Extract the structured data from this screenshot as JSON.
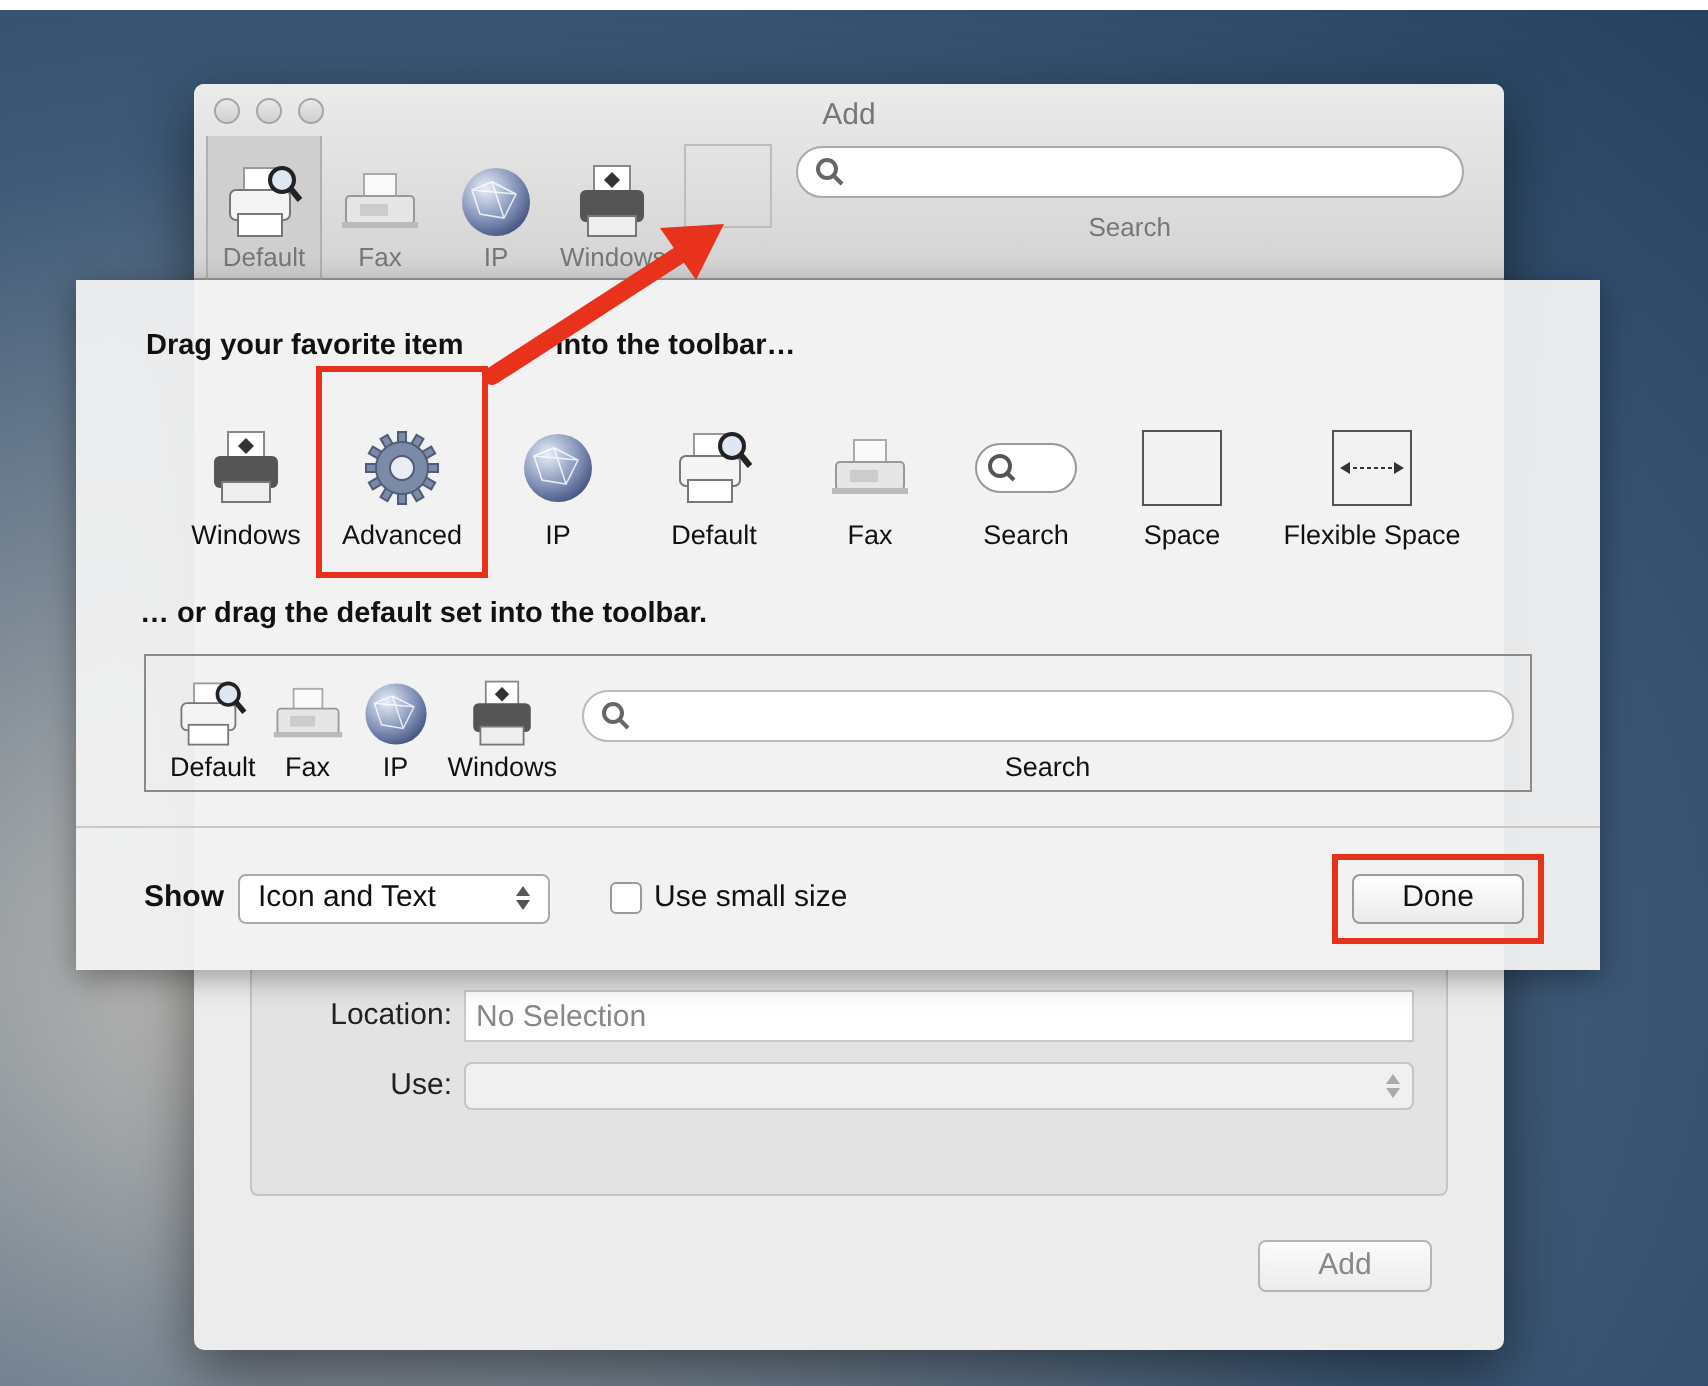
{
  "window": {
    "title": "Add",
    "toolbar": [
      {
        "kind": "printer-search",
        "label": "Default",
        "selected": true
      },
      {
        "kind": "fax",
        "label": "Fax",
        "selected": false
      },
      {
        "kind": "globe",
        "label": "IP",
        "selected": false
      },
      {
        "kind": "printer",
        "label": "Windows",
        "selected": false
      },
      {
        "kind": "space",
        "selected": false
      },
      {
        "kind": "search",
        "label": "Search",
        "selected": false
      }
    ],
    "form": {
      "location_label": "Location:",
      "location_placeholder": "No Selection",
      "use_label": "Use:"
    },
    "add_button": {
      "label": "Add",
      "disabled": true
    }
  },
  "sheet": {
    "heading_parts": [
      "Drag your favorite item",
      "into the toolbar…"
    ],
    "palette": [
      {
        "kind": "printer",
        "label": "Windows",
        "highlighted": false
      },
      {
        "kind": "gear",
        "label": "Advanced",
        "highlighted": true
      },
      {
        "kind": "globe",
        "label": "IP",
        "highlighted": false
      },
      {
        "kind": "printer-search",
        "label": "Default",
        "highlighted": false
      },
      {
        "kind": "fax",
        "label": "Fax",
        "highlighted": false
      },
      {
        "kind": "search-small",
        "label": "Search",
        "highlighted": false
      },
      {
        "kind": "space",
        "label": "Space",
        "highlighted": false
      },
      {
        "kind": "flexible-space",
        "label": "Flexible Space",
        "highlighted": false
      }
    ],
    "default_heading": "… or drag the default set into the toolbar.",
    "default_set": [
      {
        "kind": "printer-search",
        "label": "Default"
      },
      {
        "kind": "fax",
        "label": "Fax"
      },
      {
        "kind": "globe",
        "label": "IP"
      },
      {
        "kind": "printer",
        "label": "Windows"
      },
      {
        "kind": "search",
        "label": "Search"
      }
    ],
    "show_label": "Show",
    "show_value": "Icon and Text",
    "small_size": {
      "label": "Use small size",
      "checked": false
    },
    "done_button": {
      "label": "Done",
      "highlighted": true
    }
  }
}
